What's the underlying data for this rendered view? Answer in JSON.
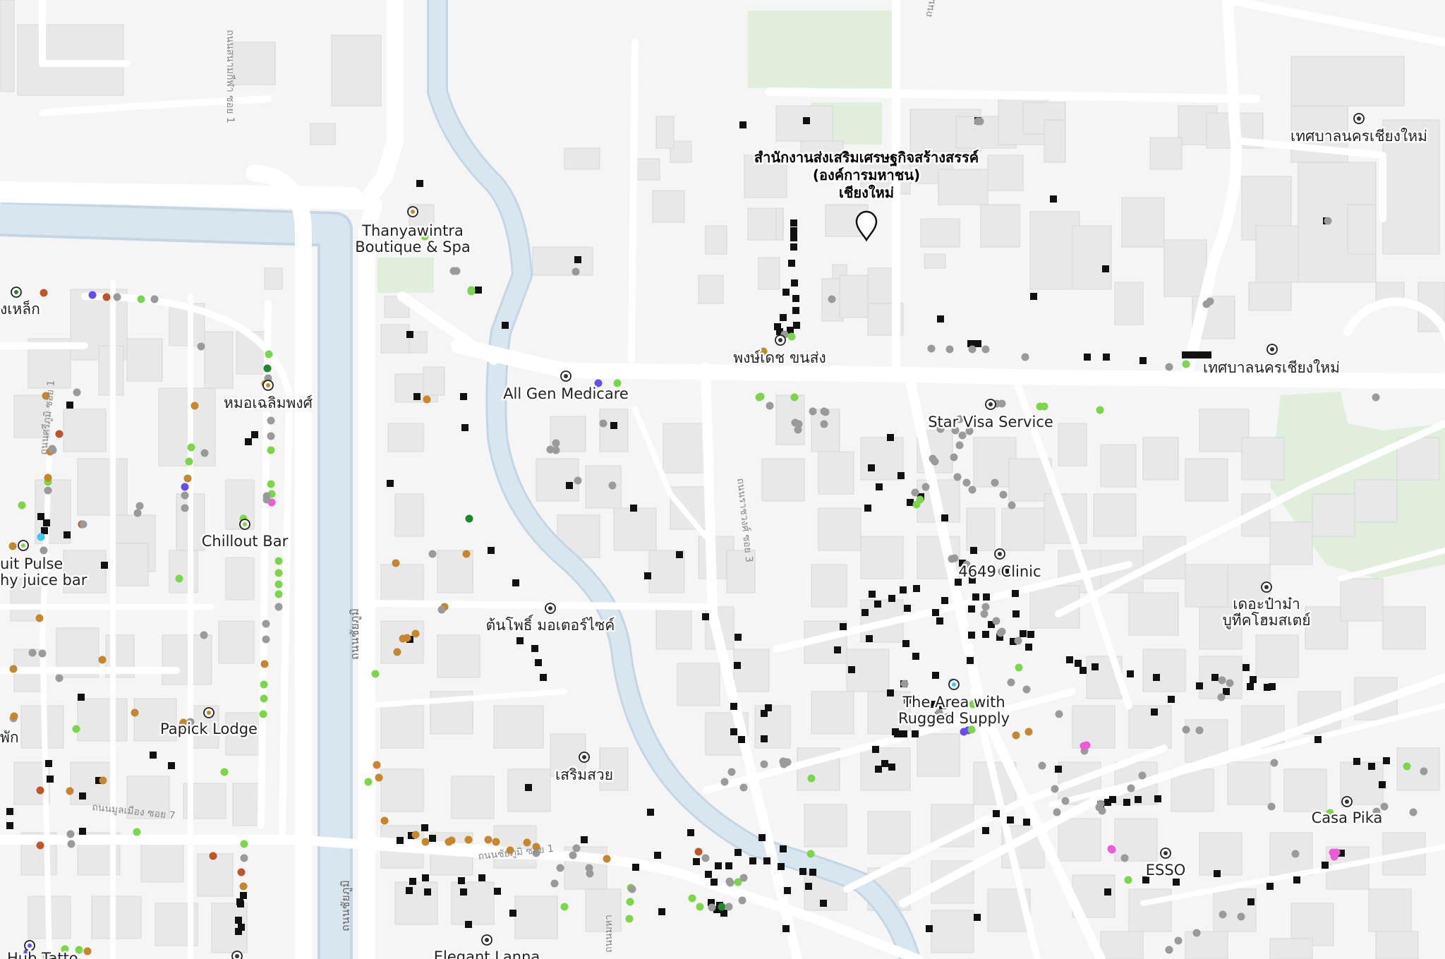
{
  "map": {
    "selected_place": {
      "title_lines": [
        "สำนักงานส่งเสริมเศรษฐกิจสร้างสรรค์",
        "(องค์การมหาชน)",
        "เชียงใหม่"
      ]
    },
    "place_labels": {
      "thanyawintra_1": "Thanyawintra",
      "thanyawintra_2": "Boutique & Spa",
      "phongdet": "พงษ์เดช ขนส่ง",
      "all_gen": "All Gen Medicare",
      "star_visa": "Star Visa Service",
      "mor_chaloem": "หมอเฉลิมพงศ์",
      "chillout": "Chillout Bar",
      "fruit_pulse_1": "uit Pulse",
      "fruit_pulse_2": "hy juice bar",
      "song_lek": "งเหล็ก",
      "clinic_4649": "4649 Clinic",
      "ton_pho": "ต้นโพธิ์ มอเตอร์ไซค์",
      "papick": "Papick Lodge",
      "the_area_1": "The Area with",
      "the_area_2": "Rugged Supply",
      "sermsuay": "เสริมสวย",
      "esso": "ESSO",
      "casa_pika": "Casa Pika",
      "the_pama_1": "เดอะป๋าม๋า",
      "the_pama_2": "บูทีคโฮมสเตย์",
      "municipality_1": "เทศบาลนครเชียงใหม่",
      "municipality_2": "เทศบาลนครเชียงใหม่",
      "elegant_lanna": "Elegant Lanna",
      "phak": "พัก",
      "hub_tattoo": "Hub Tatto"
    },
    "street_labels": {
      "sanam_kila_1": "ถนนสนามกีฬา ซอย 1",
      "chaiyaphum_1": "ถนนชัยภูมิ",
      "chaiyaphum_2": "ถนนชัยภูมิ",
      "chaiyaphum_soi_1": "ถนนชัยภูมิ ซอย 1",
      "ratchawong_3": "ถนนราชวงศ์ ซอย 3",
      "moon_muang_7": "ถนนมูลเมือง ซอย 7",
      "sri_phum_1": "ถนนศรีภูมิ ซอย 1",
      "top_right": "ถนน",
      "bottom_mid": "ถนนมหา"
    },
    "colors": {
      "background": "#f5f5f5",
      "building": "#e8e8e8",
      "building_stroke": "#d6d6d6",
      "road": "#ffffff",
      "water": "#d8e6f0",
      "water_edge": "#c4d6e4",
      "park": "#e0efdc",
      "poi_green": "#7bd64a",
      "poi_gray": "#9a9a9a",
      "poi_orange": "#c6872c",
      "poi_rust": "#c0552a",
      "poi_purple": "#6a4df0",
      "poi_pink": "#f05ad8",
      "poi_cyan": "#3cc8f0",
      "poi_darkgreen": "#1a8a2a",
      "poi_black": "#111111"
    },
    "icons": [
      "location-pin-icon",
      "poi-marker-icon",
      "poi-dot-icon",
      "poi-square-icon"
    ]
  }
}
